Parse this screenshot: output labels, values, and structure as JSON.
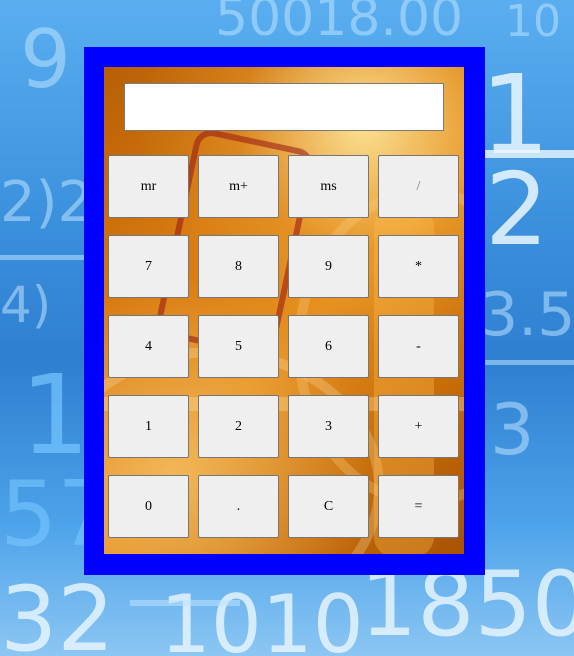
{
  "display": {
    "value": ""
  },
  "keys": {
    "mr": "mr",
    "m_plus": "m+",
    "ms": "ms",
    "divide": "/",
    "seven": "7",
    "eight": "8",
    "nine": "9",
    "multiply": "*",
    "four": "4",
    "five": "5",
    "six": "6",
    "minus": "-",
    "one": "1",
    "two": "2",
    "three": "3",
    "plus": "+",
    "zero": "0",
    "dot": ".",
    "clear": "C",
    "equals": "="
  },
  "colors": {
    "frame": "#0000ff",
    "key_background": "#efefef",
    "panel": "#d77a10"
  }
}
